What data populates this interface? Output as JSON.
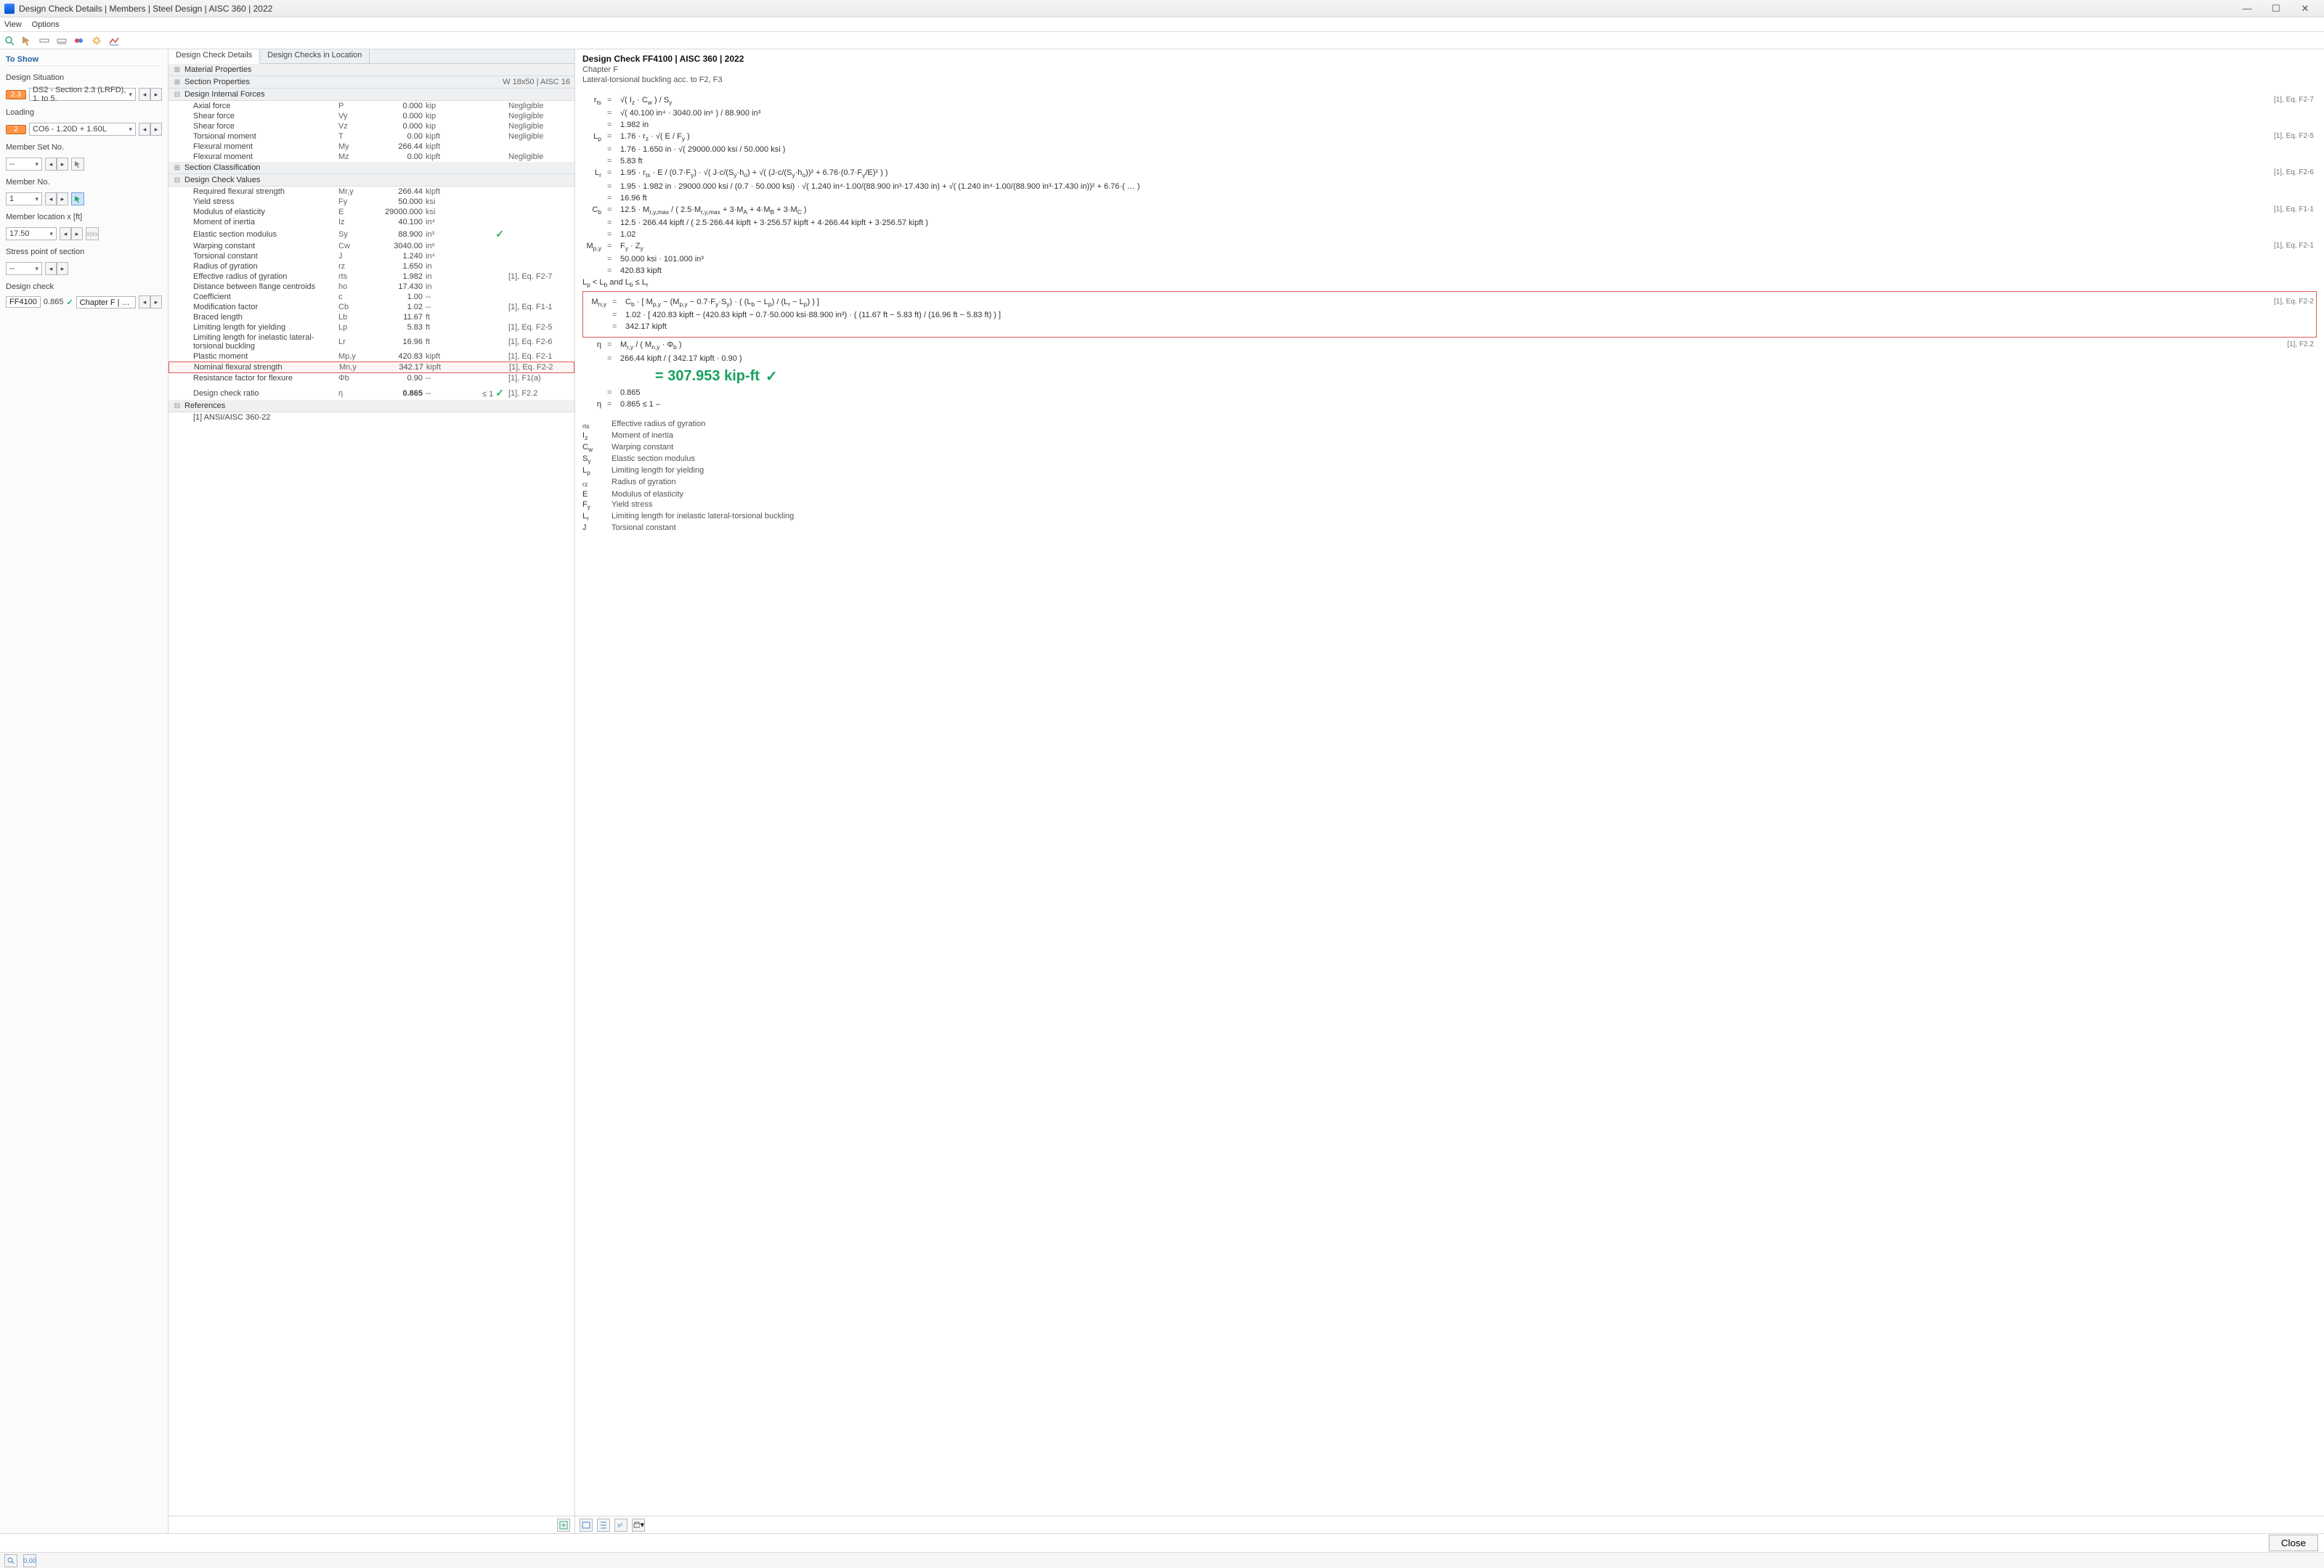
{
  "titlebar": {
    "title": "Design Check Details | Members | Steel Design | AISC 360 | 2022"
  },
  "menu": {
    "view": "View",
    "options": "Options"
  },
  "left": {
    "hdr": "To Show",
    "design_sit_lbl": "Design Situation",
    "design_sit_badge": "2.3",
    "design_sit_val": "DS2 - Section 2.3 (LRFD), 1. to 5.",
    "loading_lbl": "Loading",
    "loading_badge": "2",
    "loading_val": "CO6 - 1.20D + 1.60L",
    "memberset_lbl": "Member Set No.",
    "memberset_val": "--",
    "member_lbl": "Member No.",
    "member_val": "1",
    "memberloc_lbl": "Member location x [ft]",
    "memberloc_val": "17.50",
    "stresspt_lbl": "Stress point of section",
    "stresspt_val": "--",
    "dc_lbl": "Design check",
    "dc_id": "FF4100",
    "dc_ratio": "0.865",
    "dc_text": "Chapter F | Lateral-torsio..."
  },
  "tabs": {
    "a": "Design Check Details",
    "b": "Design Checks in Location"
  },
  "sections": {
    "matprop": "Material Properties",
    "secprop": "Section Properties",
    "secprop_r": "W 18x50 | AISC 16",
    "intforces": "Design Internal Forces",
    "class": "Section Classification",
    "dcvals": "Design Check Values",
    "refs": "References",
    "ref1": "[1]  ANSI/AISC 360-22"
  },
  "forces": [
    {
      "n": "Axial force",
      "s": "P",
      "v": "0.000",
      "u": "kip",
      "r": "Negligible"
    },
    {
      "n": "Shear force",
      "s": "Vy",
      "v": "0.000",
      "u": "kip",
      "r": "Negligible"
    },
    {
      "n": "Shear force",
      "s": "Vz",
      "v": "0.000",
      "u": "kip",
      "r": "Negligible"
    },
    {
      "n": "Torsional moment",
      "s": "T",
      "v": "0.00",
      "u": "kipft",
      "r": "Negligible"
    },
    {
      "n": "Flexural moment",
      "s": "My",
      "v": "266.44",
      "u": "kipft",
      "r": ""
    },
    {
      "n": "Flexural moment",
      "s": "Mz",
      "v": "0.00",
      "u": "kipft",
      "r": "Negligible"
    }
  ],
  "dcvals": [
    {
      "n": "Required flexural strength",
      "s": "Mr,y",
      "v": "266.44",
      "u": "kipft",
      "ref": ""
    },
    {
      "n": "Yield stress",
      "s": "Fy",
      "v": "50.000",
      "u": "ksi",
      "ref": ""
    },
    {
      "n": "Modulus of elasticity",
      "s": "E",
      "v": "29000.000",
      "u": "ksi",
      "ref": ""
    },
    {
      "n": "Moment of inertia",
      "s": "Iz",
      "v": "40.100",
      "u": "in⁴",
      "ref": ""
    },
    {
      "n": "Elastic section modulus",
      "s": "Sy",
      "v": "88.900",
      "u": "in³",
      "ref": "",
      "chk": true
    },
    {
      "n": "Warping constant",
      "s": "Cw",
      "v": "3040.00",
      "u": "in⁶",
      "ref": ""
    },
    {
      "n": "Torsional constant",
      "s": "J",
      "v": "1.240",
      "u": "in⁴",
      "ref": ""
    },
    {
      "n": "Radius of gyration",
      "s": "rz",
      "v": "1.650",
      "u": "in",
      "ref": ""
    },
    {
      "n": "Effective radius of gyration",
      "s": "rts",
      "v": "1.982",
      "u": "in",
      "ref": "[1], Eq. F2-7"
    },
    {
      "n": "Distance between flange centroids",
      "s": "ho",
      "v": "17.430",
      "u": "in",
      "ref": ""
    },
    {
      "n": "Coefficient",
      "s": "c",
      "v": "1.00",
      "u": "--",
      "ref": ""
    },
    {
      "n": "Modification factor",
      "s": "Cb",
      "v": "1.02",
      "u": "--",
      "ref": "[1], Eq. F1-1"
    },
    {
      "n": "Braced length",
      "s": "Lb",
      "v": "11.67",
      "u": "ft",
      "ref": ""
    },
    {
      "n": "Limiting length for yielding",
      "s": "Lp",
      "v": "5.83",
      "u": "ft",
      "ref": "[1], Eq. F2-5"
    },
    {
      "n": "Limiting length for inelastic lateral-torsional buckling",
      "s": "Lr",
      "v": "16.96",
      "u": "ft",
      "ref": "[1], Eq. F2-6"
    },
    {
      "n": "Plastic moment",
      "s": "Mp,y",
      "v": "420.83",
      "u": "kipft",
      "ref": "[1], Eq. F2-1"
    },
    {
      "n": "Nominal flexural strength",
      "s": "Mn,y",
      "v": "342.17",
      "u": "kipft",
      "ref": "[1], Eq. F2-2",
      "hl": true
    },
    {
      "n": "Resistance factor for flexure",
      "s": "Φb",
      "v": "0.90",
      "u": "--",
      "ref": "[1], F1(a)"
    }
  ],
  "ratio": {
    "n": "Design check ratio",
    "s": "η",
    "v": "0.865",
    "u": "--",
    "lim": "≤ 1",
    "ref": "[1], F2.2"
  },
  "rp": {
    "title": "Design Check FF4100 | AISC 360 | 2022",
    "chap": "Chapter F",
    "desc": "Lateral-torsional buckling acc. to F2, F3",
    "result": "= 307.953 kip-ft",
    "refs": {
      "f27": "[1], Eq. F2-7",
      "f25": "[1], Eq. F2-5",
      "f26": "[1], Eq. F2-6",
      "f11": "[1], Eq. F1-1",
      "f21": "[1], Eq. F2-1",
      "f22": "[1], Eq. F2-2",
      "f22b": "[1], F2.2"
    },
    "symbols": [
      {
        "s": "rts",
        "d": "Effective radius of gyration"
      },
      {
        "s": "Iz",
        "d": "Moment of inertia"
      },
      {
        "s": "Cw",
        "d": "Warping constant"
      },
      {
        "s": "Sy",
        "d": "Elastic section modulus"
      },
      {
        "s": "Lp",
        "d": "Limiting length for yielding"
      },
      {
        "s": "rz",
        "d": "Radius of gyration"
      },
      {
        "s": "E",
        "d": "Modulus of elasticity"
      },
      {
        "s": "Fy",
        "d": "Yield stress"
      },
      {
        "s": "Lr",
        "d": "Limiting length for inelastic lateral-torsional buckling"
      },
      {
        "s": "J",
        "d": "Torsional constant"
      }
    ]
  },
  "footer": {
    "close": "Close"
  }
}
